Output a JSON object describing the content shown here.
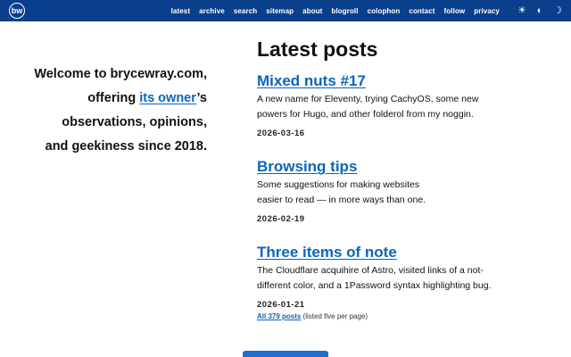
{
  "header": {
    "logo_text": "bw",
    "nav": [
      "latest",
      "archive",
      "search",
      "sitemap",
      "about",
      "blogroll",
      "colophon",
      "contact",
      "follow",
      "privacy"
    ],
    "mode_icons": [
      "sun-icon",
      "half-circle-icon",
      "moon-icon"
    ]
  },
  "welcome": {
    "line1": "Welcome to brycewray.com,",
    "line2_before": "offering ",
    "line2_link": "its owner",
    "line2_after": "’s",
    "line3": "observations, opinions,",
    "line4": "and geekiness since 2018."
  },
  "main": {
    "heading": "Latest posts",
    "posts": [
      {
        "title": "Mixed nuts #17",
        "summary": "A new name for Eleventy, trying CachyOS, some new powers for Hugo, and other folderol from my noggin.",
        "date": "2026-03-16"
      },
      {
        "title": "Browsing tips",
        "summary": "Some suggestions for making websites easier to read — in more ways than one.",
        "date": "2026-02-19"
      },
      {
        "title": "Three items of note",
        "summary": "The Cloudflare acquihire of Astro, visited links of a not-different color, and a 1Password syntax highlighting bug.",
        "date": "2026-01-21"
      }
    ],
    "all_posts_link": "All 379 posts",
    "all_posts_note": " (listed five per page)"
  },
  "colors": {
    "header_bg": "#0b3f8c",
    "link": "#0a66b8",
    "button": "#1e6fd1"
  }
}
